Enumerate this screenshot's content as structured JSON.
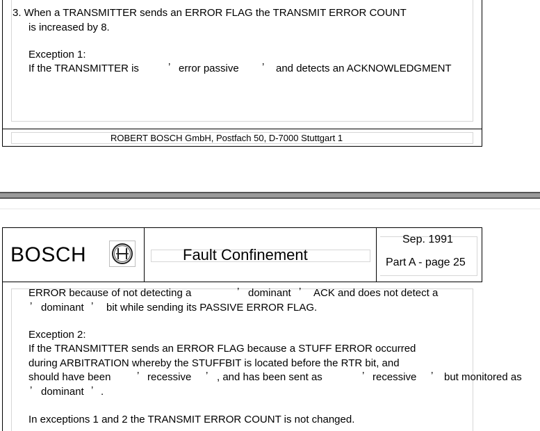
{
  "page1": {
    "item3_line1": "3.  When a TRANSMITTER sends an ERROR FLAG the TRANSMIT ERROR COUNT",
    "item3_line2": "is increased by 8.",
    "exception1_heading": "Exception 1:",
    "exception1_a": "If the TRANSMITTER is",
    "exception1_b": "error passive",
    "exception1_c": "and detects an ACKNOWLEDGMENT",
    "footer": "ROBERT BOSCH GmbH, Postfach 50, D-7000 Stuttgart 1"
  },
  "page2": {
    "logo_text": "BOSCH",
    "title": "Fault Confinement",
    "date": "Sep. 1991",
    "page_ref": "Part A - page 25",
    "cont1_a": "ERROR because of not detecting a",
    "cont1_b": "dominant",
    "cont1_c": "ACK and does not detect a",
    "cont2_b": "dominant",
    "cont2_c": "bit while sending its PASSIVE ERROR FLAG.",
    "exception2_heading": "Exception 2:",
    "exception2_line1": "If the TRANSMITTER sends an ERROR FLAG because a STUFF ERROR occurred",
    "exception2_line2": "during ARBITRATION whereby the STUFFBIT is located before the RTR bit, and",
    "exception2_line3_a": "should have been",
    "exception2_line3_b": "recessive",
    "exception2_line3_c": ", and has been sent as",
    "exception2_line3_d": "recessive",
    "exception2_line3_e": "but monitored as",
    "exception2_line4_b": "dominant",
    "exception2_line4_c": ".",
    "summary": "In exceptions 1 and 2 the TRANSMIT ERROR COUNT is not changed."
  },
  "quote_mark": "’"
}
